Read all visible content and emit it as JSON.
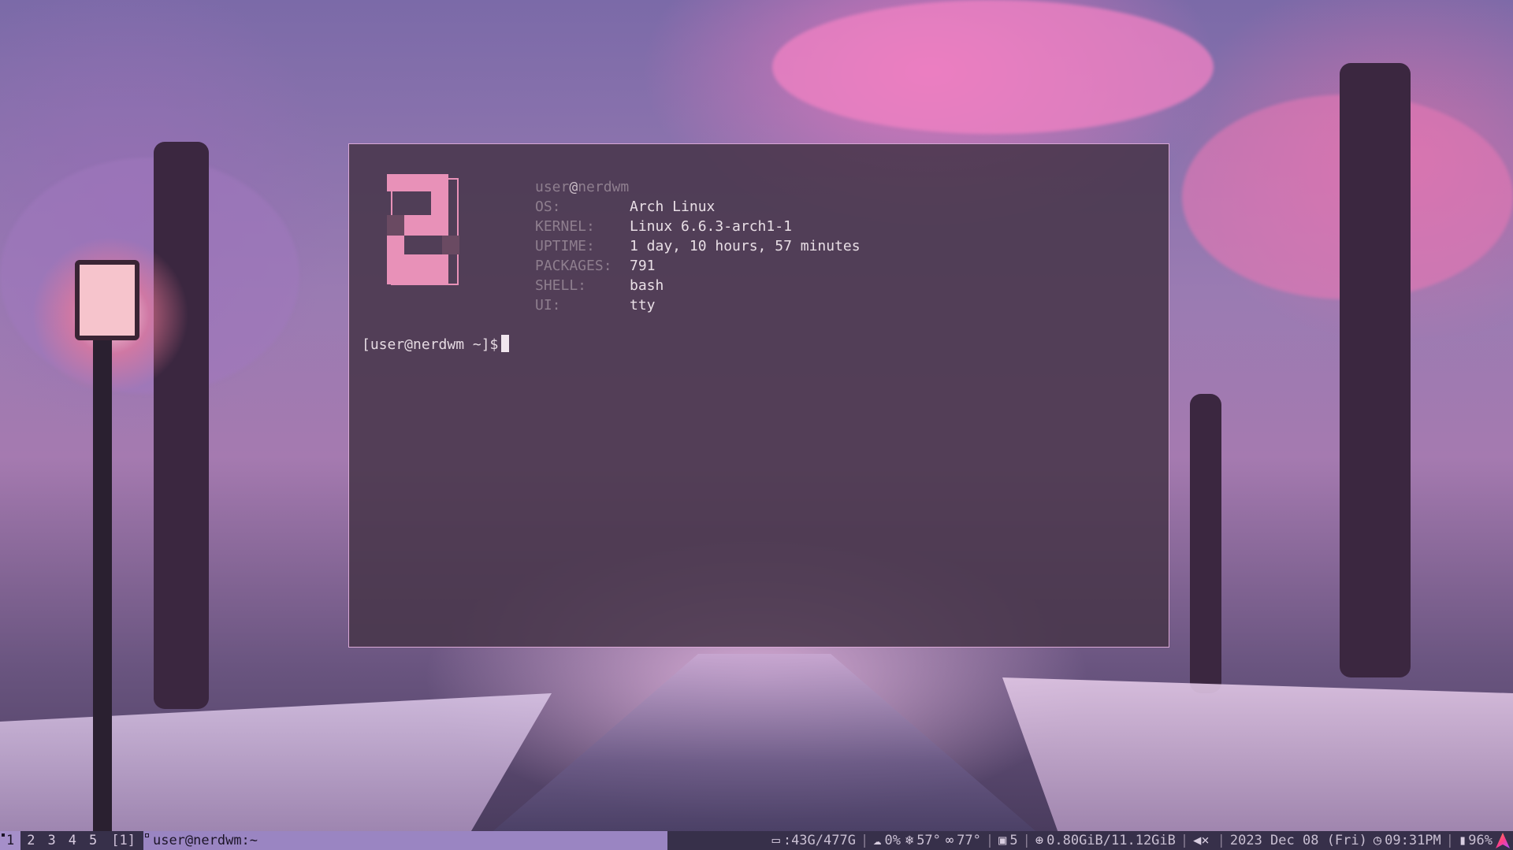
{
  "terminal": {
    "fetch_title_user": "user",
    "fetch_title_at": "@",
    "fetch_title_host": "nerdwm",
    "fields": [
      {
        "key": "OS:",
        "value": "Arch Linux"
      },
      {
        "key": "KERNEL:",
        "value": "Linux 6.6.3-arch1-1"
      },
      {
        "key": "UPTIME:",
        "value": "1 day, 10 hours, 57 minutes"
      },
      {
        "key": "PACKAGES:",
        "value": "791"
      },
      {
        "key": "SHELL:",
        "value": "bash"
      },
      {
        "key": "UI:",
        "value": "tty"
      }
    ],
    "prompt": "[user@nerdwm ~]$",
    "logo_color": "#e891b8"
  },
  "statusbar": {
    "tags": [
      "1",
      "2",
      "3",
      "4",
      "5"
    ],
    "active_tag": "1",
    "layout": "[1]",
    "window_title": "user@nerdwm:~",
    "disk": "43G/477G",
    "disk_label": ":",
    "rain": "0%",
    "temp_cold": "57°",
    "temp_feels": "77°",
    "updates": "5",
    "memory": "0.80GiB/11.12GiB",
    "datetime": "2023 Dec 08 (Fri)",
    "time": "09:31PM",
    "battery": "96%",
    "icons": {
      "disk": "monitor-icon",
      "rain": "cloud-icon",
      "temp_cold": "snowflake-icon",
      "temp_feels": "glasses-icon",
      "updates": "package-icon",
      "memory": "memory-icon",
      "volume": "mute-icon",
      "clock": "clock-icon",
      "battery": "battery-icon",
      "logo": "arch-icon"
    },
    "colors": {
      "accent": "#9a85c2",
      "bar_bg": "#37304a"
    }
  }
}
